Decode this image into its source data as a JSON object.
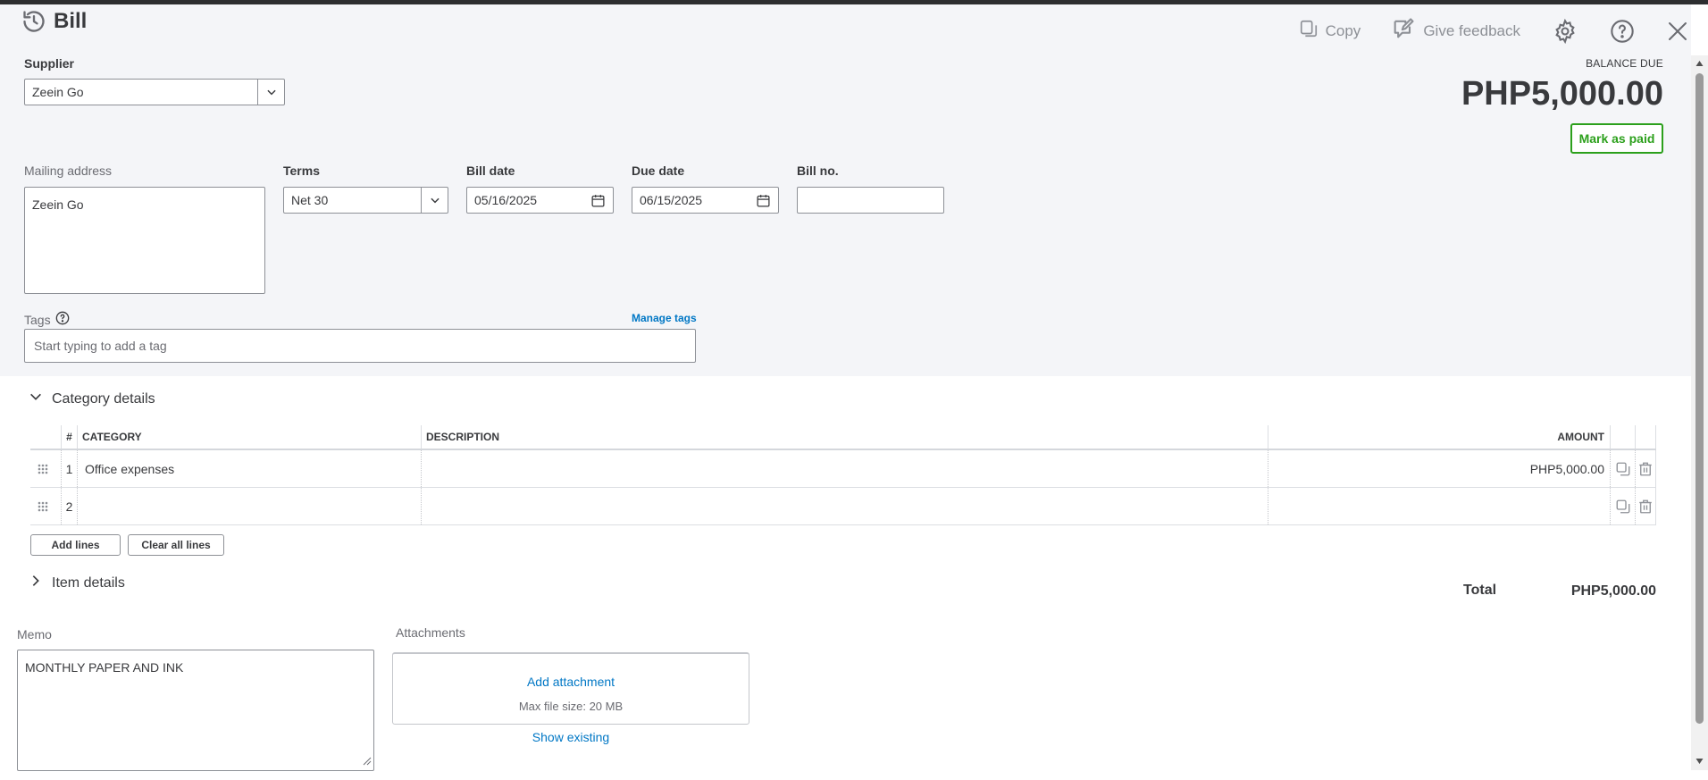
{
  "header": {
    "title": "Bill",
    "copy_label": "Copy",
    "feedback_label": "Give feedback"
  },
  "supplier": {
    "label": "Supplier",
    "value": "Zeein Go"
  },
  "balance": {
    "label": "BALANCE DUE",
    "amount": "PHP5,000.00",
    "mark_paid_label": "Mark as paid"
  },
  "mailing": {
    "label": "Mailing address",
    "value": "Zeein Go"
  },
  "terms": {
    "label": "Terms",
    "value": "Net 30"
  },
  "bill_date": {
    "label": "Bill date",
    "value": "05/16/2025"
  },
  "due_date": {
    "label": "Due date",
    "value": "06/15/2025"
  },
  "bill_no": {
    "label": "Bill no.",
    "value": ""
  },
  "tags": {
    "label": "Tags",
    "manage_label": "Manage tags",
    "placeholder": "Start typing to add a tag"
  },
  "category_details": {
    "title": "Category details",
    "columns": {
      "num": "#",
      "category": "CATEGORY",
      "description": "DESCRIPTION",
      "amount": "AMOUNT"
    },
    "rows": [
      {
        "num": "1",
        "category": "Office expenses",
        "description": "",
        "amount": "PHP5,000.00"
      },
      {
        "num": "2",
        "category": "",
        "description": "",
        "amount": ""
      }
    ],
    "add_lines_label": "Add lines",
    "clear_lines_label": "Clear all lines"
  },
  "item_details": {
    "title": "Item details"
  },
  "total": {
    "label": "Total",
    "amount": "PHP5,000.00"
  },
  "memo": {
    "label": "Memo",
    "value": "MONTHLY PAPER AND INK"
  },
  "attachments": {
    "label": "Attachments",
    "add_label": "Add attachment",
    "max_size": "Max file size: 20 MB",
    "show_existing": "Show existing"
  },
  "colors": {
    "accent_green": "#2ca01c",
    "link_blue": "#0077c5",
    "header_bg": "#f4f5f8"
  },
  "icons": [
    "history-icon",
    "copy-icon",
    "feedback-icon",
    "gear-icon",
    "help-icon",
    "close-icon",
    "chevron-down-icon",
    "calendar-icon",
    "question-circle-icon",
    "drag-handle-icon",
    "duplicate-icon",
    "trash-icon",
    "chevron-right-icon"
  ]
}
